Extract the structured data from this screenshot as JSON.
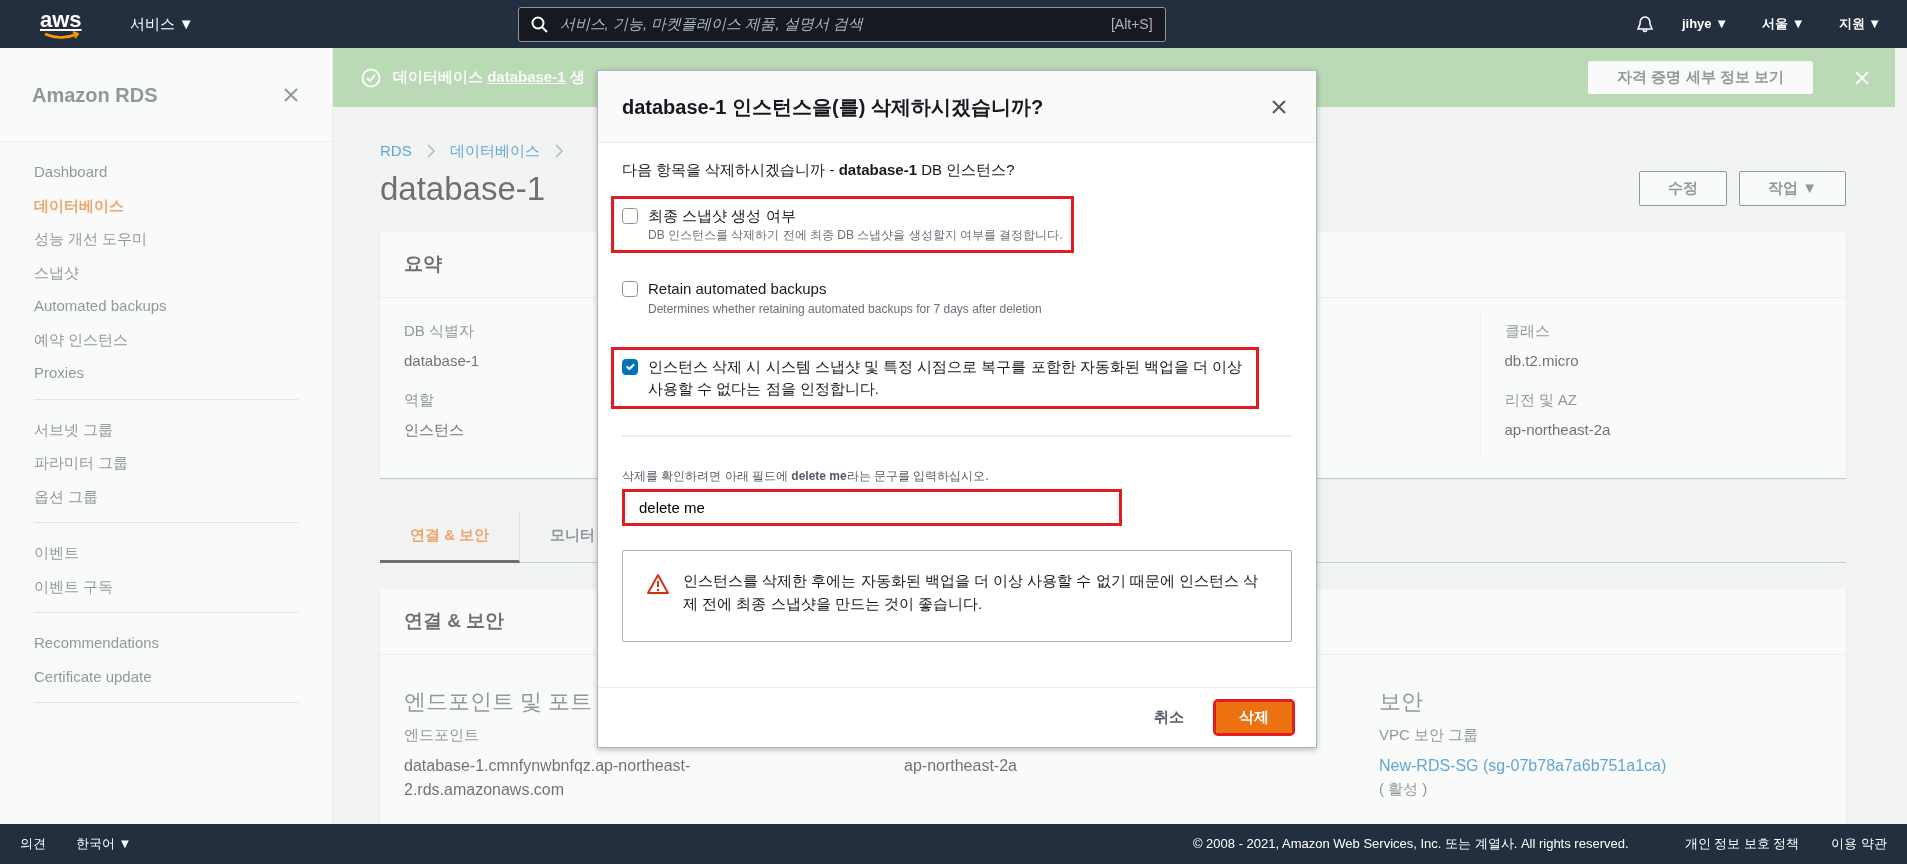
{
  "top_nav": {
    "logo": "aws",
    "services": {
      "label": "서비스",
      "caret": "▼"
    },
    "search": {
      "placeholder": "서비스, 기능, 마켓플레이스 제품, 설명서 검색",
      "shortcut": "[Alt+S]"
    },
    "menus": [
      {
        "label": "jihye",
        "caret": "▼"
      },
      {
        "label": "서울",
        "caret": "▼"
      },
      {
        "label": "지원",
        "caret": "▼"
      }
    ]
  },
  "sidebar": {
    "title": "Amazon RDS",
    "groups": [
      [
        {
          "label": "Dashboard",
          "selected": false
        },
        {
          "label": "데이터베이스",
          "selected": true
        },
        {
          "label": "성능 개선 도우미",
          "selected": false
        },
        {
          "label": "스냅샷",
          "selected": false
        },
        {
          "label": "Automated backups",
          "selected": false
        },
        {
          "label": "예약 인스턴스",
          "selected": false
        },
        {
          "label": "Proxies",
          "selected": false
        }
      ],
      [
        {
          "label": "서브넷 그룹",
          "selected": false
        },
        {
          "label": "파라미터 그룹",
          "selected": false
        },
        {
          "label": "옵션 그룹",
          "selected": false
        }
      ],
      [
        {
          "label": "이벤트",
          "selected": false
        },
        {
          "label": "이벤트 구독",
          "selected": false
        }
      ],
      [
        {
          "label": "Recommendations",
          "selected": false
        },
        {
          "label": "Certificate update",
          "selected": false
        }
      ]
    ]
  },
  "banner": {
    "text": "데이터베이스",
    "link": "database-1",
    "text_after": "생",
    "button": "자격 증명 세부 정보 보기"
  },
  "breadcrumb": [
    "RDS",
    "데이터베이스"
  ],
  "page_title": "database-1",
  "actions": [
    {
      "label": "수정"
    },
    {
      "label": "작업",
      "caret": "▼"
    }
  ],
  "summary": {
    "title": "요약",
    "columns": [
      [
        {
          "label": "DB 식별자",
          "value": "database-1"
        },
        {
          "label": "역할",
          "value": "인스턴스"
        }
      ],
      [],
      [],
      [
        {
          "label": "클래스",
          "value": "db.t2.micro"
        },
        {
          "label": "리전 및 AZ",
          "value": "ap-northeast-2a"
        }
      ]
    ]
  },
  "tabs": [
    {
      "label": "연결 & 보안",
      "selected": true
    },
    {
      "label": "모니터",
      "selected": false
    }
  ],
  "connectivity": {
    "title": "연결 & 보안",
    "columns": [
      {
        "heading": "엔드포인트 및 포트",
        "label": "엔드포인트",
        "value": "database-1.cmnfynwbnfqz.ap-northeast-2.rds.amazonaws.com",
        "link": false
      },
      {
        "value": "ap-northeast-2a",
        "link": false
      },
      {
        "heading": "보안",
        "label": "VPC 보안 그룹",
        "value": "New-RDS-SG (sg-07b78a7a6b751a1ca)",
        "link": true,
        "note": "( 활성 )"
      }
    ]
  },
  "modal": {
    "title": "database-1 인스턴스을(를) 삭제하시겠습니까?",
    "question": "다음 항목을 삭제하시겠습니까 - **database-1** DB 인스턴스?",
    "options": [
      {
        "label": "최종 스냅샷 생성 여부",
        "description": "DB 인스턴스를 삭제하기 전에 최종 DB 스냅샷을 생성할지 여부를 결정합니다.",
        "checked": false,
        "highlighted": true
      },
      {
        "label": "Retain automated backups",
        "description": "Determines whether retaining automated backups for 7 days after deletion",
        "checked": false,
        "highlighted": false
      },
      {
        "label": "인스턴스 삭제 시 시스템 스냅샷 및 특정 시점으로 복구를 포함한 자동화된 백업을 더 이상 사용할 수 없다는 점을 인정합니다.",
        "checked": true,
        "highlighted": true
      }
    ],
    "confirm_label": "삭제를 확인하려면 아래 필드에 **delete me**라는 문구를 입력하십시오.",
    "confirm_input": {
      "value": "delete me",
      "highlighted": true
    },
    "warning": "인스턴스를 삭제한 후에는 자동화된 백업을 더 이상 사용할 수 없기 때문에 인스턴스 삭제 전에 최종 스냅샷을 만드는 것이 좋습니다.",
    "cancel": "취소",
    "delete": {
      "label": "삭제",
      "highlighted": true
    }
  },
  "footer": {
    "feedback": "의견",
    "language": {
      "label": "한국어",
      "caret": "▼"
    },
    "copyright": "© 2008 - 2021, Amazon Web Services, Inc. 또는 계열사. All rights reserved.",
    "links": [
      "개인 정보 보호 정책",
      "이용 약관"
    ]
  }
}
